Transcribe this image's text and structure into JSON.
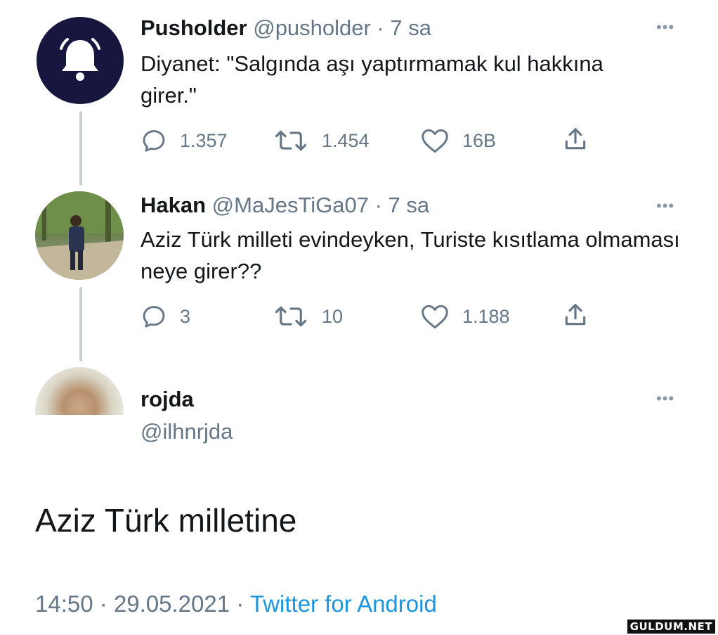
{
  "tweets": [
    {
      "name": "Pusholder",
      "handle": "@pusholder",
      "time": "· 7 sa",
      "text": "Diyanet: \"Salgında aşı yaptırmamak kul hakkına girer.\"",
      "replies": "1.357",
      "retweets": "1.454",
      "likes": "16B",
      "avatar_icon": "bell-icon"
    },
    {
      "name": "Hakan",
      "handle": "@MaJesTiGa07",
      "time": "· 7 sa",
      "text": "Aziz Türk milleti evindeyken, Turiste kısıtlama olmaması neye girer??",
      "replies": "3",
      "retweets": "10",
      "likes": "1.188"
    }
  ],
  "main_tweet": {
    "name": "rojda",
    "handle": "@ilhnrjda",
    "text": "Aziz Türk milletine",
    "time": "14:50",
    "date": "29.05.2021",
    "source": "Twitter for Android"
  },
  "more_symbol": "•••",
  "watermark": "GULDUM.NET",
  "colors": {
    "text": "#14171a",
    "secondary": "#657786",
    "link": "#1b95e0",
    "thread_line": "#c9d0d6",
    "bell_avatar_bg": "#16163f"
  }
}
